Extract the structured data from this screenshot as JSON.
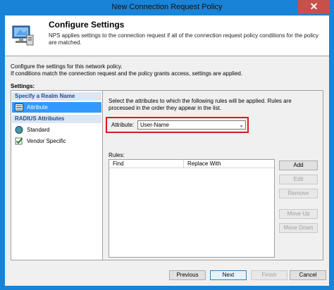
{
  "window": {
    "title": "New Connection Request Policy",
    "close_glyph": "✕"
  },
  "header": {
    "title": "Configure Settings",
    "description": "NPS applies settings to the connection request if all of the connection request policy conditions  for the policy are matched.",
    "icon": "network-monitor-icon"
  },
  "intro": {
    "line1": "Configure the settings for this network policy.",
    "line2": "If conditions match the connection request and the policy grants access, settings are applied."
  },
  "settings_label": "Settings:",
  "nav": {
    "category1": "Specify a Realm Name",
    "category2": "RADIUS Attributes",
    "items": [
      {
        "label": "Attribute",
        "icon": "list-icon",
        "selected": true
      },
      {
        "label": "Standard",
        "icon": "globe-icon",
        "selected": false
      },
      {
        "label": "Vendor Specific",
        "icon": "checkmark-icon",
        "selected": false
      }
    ]
  },
  "panel": {
    "description": "Select the attributes to which the following rules will be applied. Rules are processed in the order they appear in the list.",
    "attribute_label": "Attribute:",
    "attribute_value": "User-Name",
    "rules_label": "Rules:",
    "columns": [
      "Find",
      "Replace With"
    ],
    "buttons": {
      "add": "Add",
      "edit": "Edit",
      "remove": "Remove",
      "move_up": "Move Up",
      "move_down": "Move Down"
    }
  },
  "footer": {
    "previous": "Previous",
    "next": "Next",
    "finish": "Finish",
    "cancel": "Cancel"
  },
  "colors": {
    "titlebar": "#1883d7",
    "close": "#c7504a",
    "selection": "#3399ff",
    "highlight_border": "#d51d1d"
  }
}
